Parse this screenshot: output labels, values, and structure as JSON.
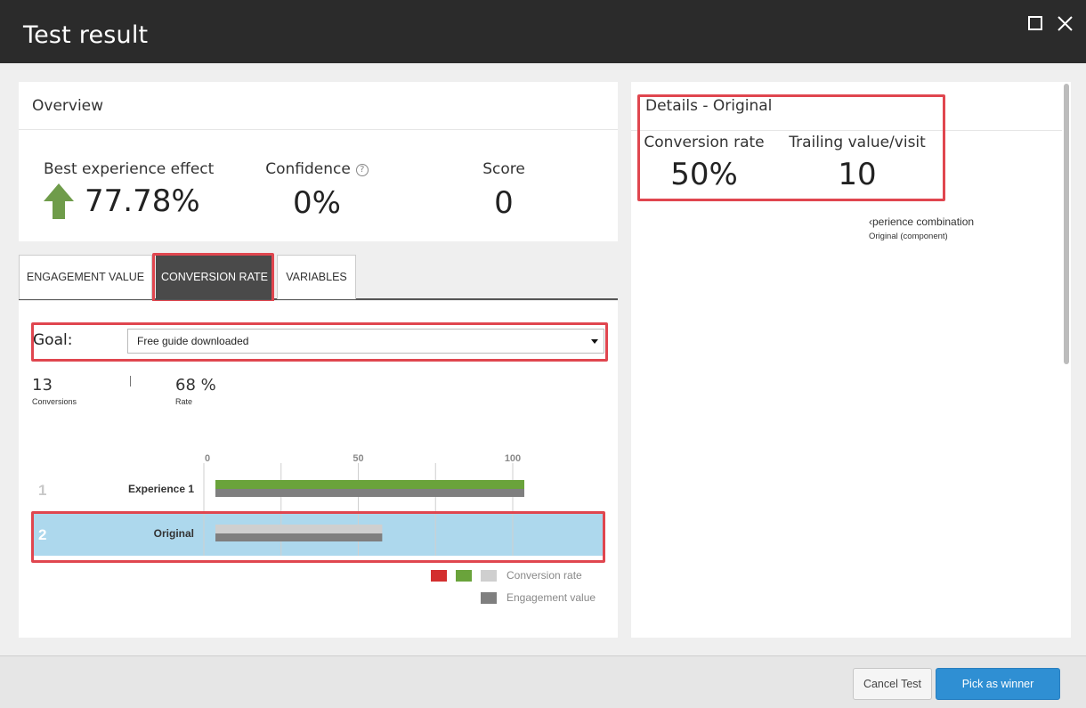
{
  "window": {
    "title": "Test result",
    "maximize_icon": "square-icon",
    "close_icon": "x-icon"
  },
  "overview": {
    "header": "Overview",
    "best_effect_label": "Best experience effect",
    "best_effect_value": "77.78%",
    "best_effect_icon": "up-arrow-icon",
    "confidence_label": "Confidence",
    "confidence_help": "?",
    "confidence_value": "0%",
    "score_label": "Score",
    "score_value": "0"
  },
  "tabs": [
    "ENGAGEMENT VALUE",
    "CONVERSION RATE",
    "VARIABLES"
  ],
  "active_tab": "CONVERSION RATE",
  "goal": {
    "label": "Goal:",
    "selected": "Free guide downloaded"
  },
  "stats": {
    "conversions_value": "13",
    "conversions_label": "Conversions",
    "rate_value": "68 %",
    "rate_label": "Rate"
  },
  "chart_data": {
    "type": "bar",
    "orientation": "horizontal",
    "x_ticks": [
      "0",
      "50",
      "100"
    ],
    "xlim": [
      0,
      100
    ],
    "categories": [
      {
        "rank": "1",
        "name": "Experience 1"
      },
      {
        "rank": "2",
        "name": "Original",
        "selected": true
      }
    ],
    "series": [
      {
        "name": "Conversion rate",
        "values": [
          100,
          54
        ]
      },
      {
        "name": "Engagement value",
        "values": [
          100,
          54
        ]
      }
    ],
    "legend": [
      "Conversion rate",
      "Engagement value"
    ],
    "colors": {
      "positive": "#6aa33b",
      "negative": "#d32f2f",
      "neutral": "#cfcfcf",
      "engagement": "#7f7f7f",
      "selected_row": "#add8ed"
    }
  },
  "details": {
    "header": "Details - Original",
    "conversion_label": "Conversion rate",
    "conversion_value": "50%",
    "trailing_label": "Trailing value/visit",
    "trailing_value": "10",
    "combo_label": "‹perience combination",
    "combo_sub": "Original (component)"
  },
  "footer": {
    "cancel_label": "Cancel Test",
    "pick_label": "Pick as winner"
  }
}
